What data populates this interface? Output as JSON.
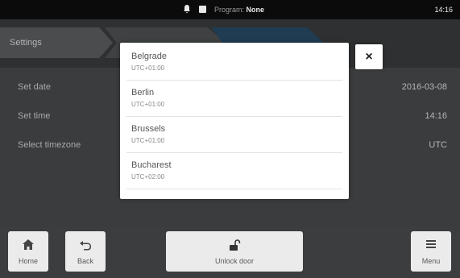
{
  "status_bar": {
    "bell_icon": "bell-icon",
    "door_icon": "door-square-icon",
    "program_label": "Program:",
    "program_value": "None",
    "clock": "14:16"
  },
  "breadcrumb": {
    "items": [
      "Settings"
    ]
  },
  "settings_rows": [
    {
      "label": "Set date",
      "value": "2016-03-08"
    },
    {
      "label": "Set time",
      "value": "14:16"
    },
    {
      "label": "Select timezone",
      "value": "UTC"
    }
  ],
  "timezone_dialog": {
    "options": [
      {
        "city": "Belgrade",
        "offset": "UTC+01:00"
      },
      {
        "city": "Berlin",
        "offset": "UTC+01:00"
      },
      {
        "city": "Brussels",
        "offset": "UTC+01:00"
      },
      {
        "city": "Bucharest",
        "offset": "UTC+02:00"
      }
    ],
    "close_symbol": "×"
  },
  "bottom_bar": {
    "home_label": "Home",
    "back_label": "Back",
    "unlock_label": "Unlock door",
    "menu_label": "Menu",
    "home_icon_glyph": "⌂",
    "back_icon_glyph": "⮌",
    "unlock_icon_glyph": "🔓",
    "menu_icon_glyph": "≡"
  }
}
